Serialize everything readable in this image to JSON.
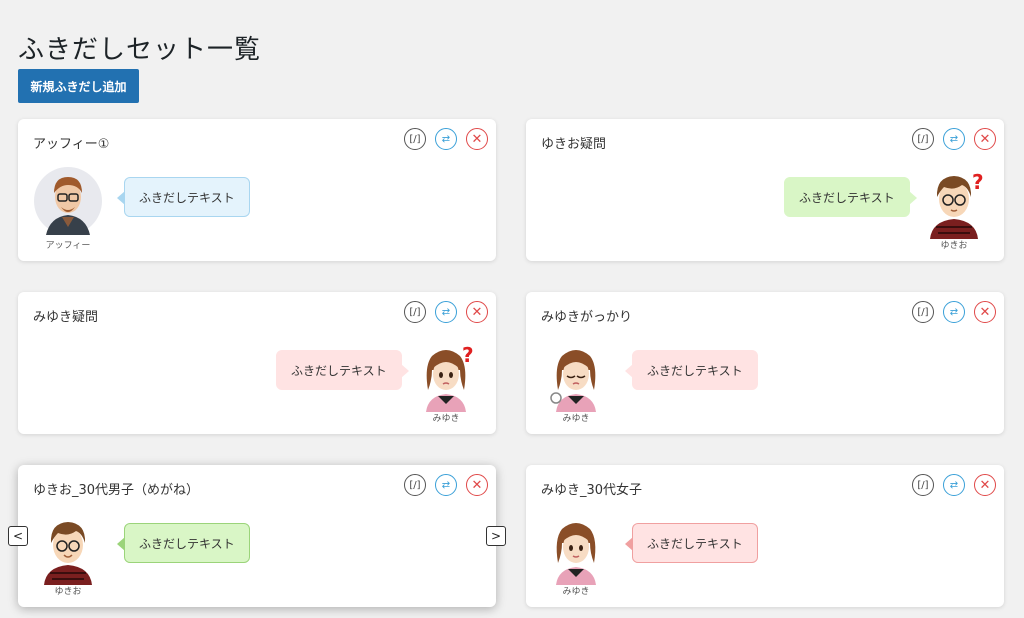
{
  "page": {
    "title": "ふきだしセット一覧",
    "add_button": "新規ふきだし追加"
  },
  "actions": {
    "edit": "[/]",
    "copy": "⇄",
    "delete": "✕"
  },
  "carousel": {
    "prev": "<",
    "next": ">"
  },
  "cards": [
    {
      "title": "アッフィー①",
      "avatar_name": "アッフィー",
      "text": "ふきだしテキスト",
      "color": "#e4f3fc"
    },
    {
      "title": "ゆきお疑問",
      "avatar_name": "ゆきお",
      "text": "ふきだしテキスト",
      "color": "#d9f6c6"
    },
    {
      "title": "みゆき疑問",
      "avatar_name": "みゆき",
      "text": "ふきだしテキスト",
      "color": "#ffe3e3"
    },
    {
      "title": "みゆきがっかり",
      "avatar_name": "みゆき",
      "text": "ふきだしテキスト",
      "color": "#ffe3e3"
    },
    {
      "title": "ゆきお_30代男子（めがね）",
      "avatar_name": "ゆきお",
      "text": "ふきだしテキスト",
      "color": "#d9f6c6"
    },
    {
      "title": "みゆき_30代女子",
      "avatar_name": "みゆき",
      "text": "ふきだしテキスト",
      "color": "#ffe3e3"
    }
  ],
  "colors": {
    "primary": "#2271b1",
    "edit": "#555555",
    "copy": "#3aa0d8",
    "delete": "#e04848"
  },
  "icons": [
    "edit-icon",
    "copy-icon",
    "delete-icon",
    "chevron-left-icon",
    "chevron-right-icon",
    "question-mark-icon"
  ]
}
